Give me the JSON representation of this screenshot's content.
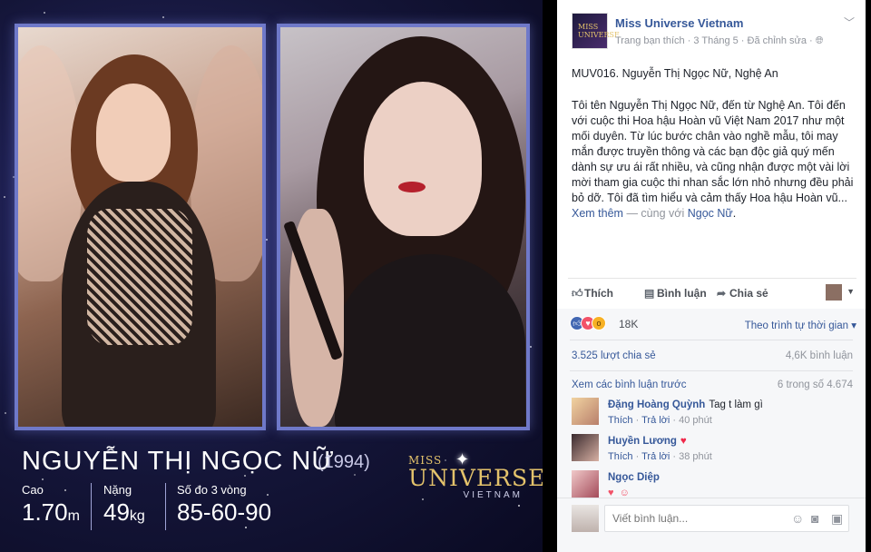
{
  "photo": {
    "name": "NGUYỄN THỊ NGỌC NỮ",
    "birth_year": "(1994)",
    "stats": [
      {
        "label": "Cao",
        "value": "1.70",
        "unit": "m"
      },
      {
        "label": "Nặng",
        "value": "49",
        "unit": "kg"
      },
      {
        "label": "Số đo 3 vòng",
        "value": "85-60-90",
        "unit": ""
      }
    ],
    "logo": {
      "miss": "MISS",
      "universe": "UNIVERSE",
      "vietnam": "VIETNAM"
    }
  },
  "post": {
    "page_name": "Miss Universe Vietnam",
    "meta": "Trang bạn thích · 3 Tháng 5 · Đã chỉnh sửa ·",
    "title": "MUV016. Nguyễn Thị Ngọc Nữ, Nghệ An",
    "body": "Tôi tên Nguyễn Thị Ngọc Nữ, đến từ Nghệ An. Tôi đến với cuộc thi Hoa hậu Hoàn vũ Việt Nam 2017 như một mối duyên. Từ lúc bước chân vào nghề mẫu, tôi may mắn được truyền thông và các bạn độc giả quý mến dành sự ưu ái rất nhiều, và cũng nhận được một vài lời mời tham gia cuộc thi nhan sắc lớn nhỏ nhưng đều phải bỏ dỡ. Tôi đã tìm hiểu và cảm thấy Hoa hậu Hoàn vũ...",
    "see_more": "Xem thêm",
    "with_text": "— cùng với",
    "tagged": "Ngọc Nữ",
    "avatar_text": "MISS UNIVERSE"
  },
  "actions": {
    "like": "Thích",
    "comment": "Bình luận",
    "share": "Chia sẻ"
  },
  "stats": {
    "reactions": "18K",
    "sort": "Theo trình tự thời gian",
    "shares": "3.525 lượt chia sẻ",
    "comments": "4,6K bình luận",
    "prev_comments": "Xem các bình luận trước",
    "paging": "6 trong số 4.674"
  },
  "comments": [
    {
      "name": "Đặng Hoàng Quỳnh",
      "text": "Tag t làm gì",
      "like": "Thích",
      "reply": "Trả lời",
      "time": "40 phút"
    },
    {
      "name": "Huyền Lương",
      "text": "",
      "like": "Thích",
      "reply": "Trả lời",
      "time": "38 phút"
    },
    {
      "name": "Ngọc Diệp",
      "text": "",
      "like": "",
      "reply": "",
      "time": ""
    }
  ],
  "write": {
    "placeholder": "Viết bình luận..."
  },
  "icons": {
    "like": "thumbs-up-icon",
    "comment": "comment-icon",
    "share": "share-icon",
    "emoji": "emoji-icon",
    "camera": "camera-icon",
    "sticker": "sticker-icon"
  },
  "colors": {
    "link": "#365899",
    "panel_bg": "#141538",
    "logo_gold": "#e3c26b"
  }
}
